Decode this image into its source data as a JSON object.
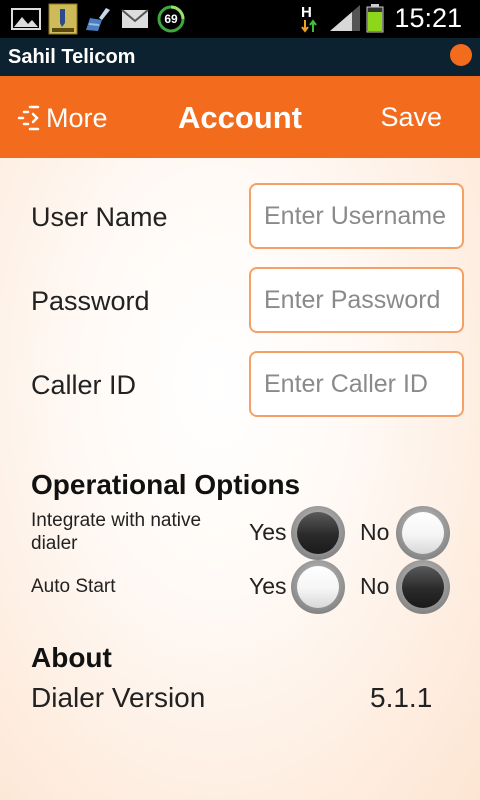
{
  "status_bar": {
    "time": "15:21",
    "battery_color": "#8ed61a",
    "notification_icons": [
      "image-icon",
      "app-thumbnail-icon",
      "cleaner-broom-icon",
      "mail-icon",
      "speed-badge-icon"
    ],
    "speed_badge_value": "69",
    "network_type": "H"
  },
  "app": {
    "name": "Sahil Telicom",
    "accent_color": "#f36b1c"
  },
  "header": {
    "more_label": "More",
    "title": "Account",
    "save_label": "Save"
  },
  "form": {
    "username": {
      "label": "User Name",
      "placeholder": "Enter Username",
      "value": ""
    },
    "password": {
      "label": "Password",
      "placeholder": "Enter Password",
      "value": ""
    },
    "caller_id": {
      "label": "Caller ID",
      "placeholder": "Enter Caller ID",
      "value": ""
    }
  },
  "operational": {
    "title": "Operational Options",
    "yes_label": "Yes",
    "no_label": "No",
    "options": [
      {
        "label_line1": "Integrate with native",
        "label_line2": "dialer",
        "selected": "Yes"
      },
      {
        "label_line1": "Auto Start",
        "label_line2": "",
        "selected": "No"
      }
    ]
  },
  "about": {
    "title": "About",
    "version_label": "Dialer Version",
    "version_value": "5.1.1"
  }
}
